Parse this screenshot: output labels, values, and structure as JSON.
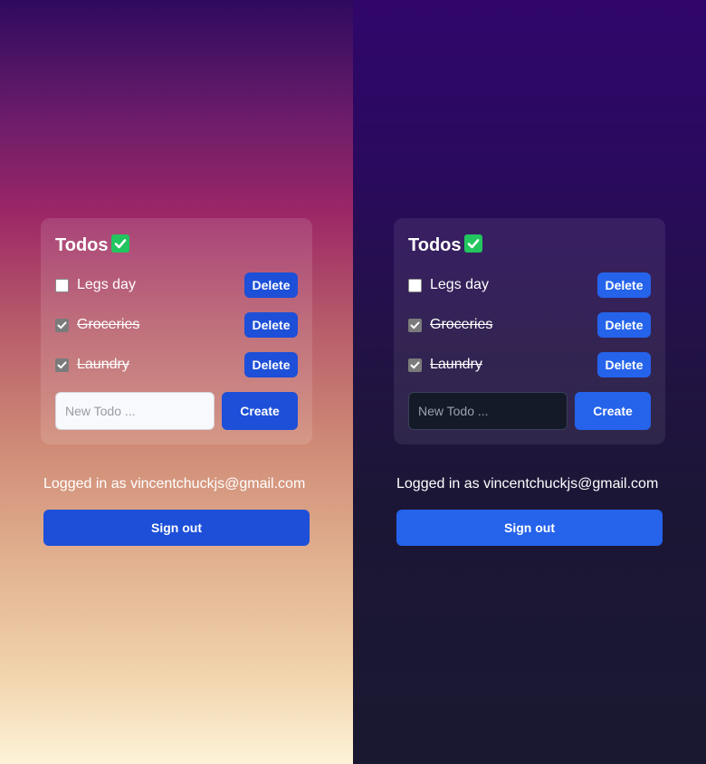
{
  "panels": [
    {
      "theme": "light",
      "title": "Todos",
      "todos": [
        {
          "label": "Legs day",
          "done": false,
          "delete_label": "Delete"
        },
        {
          "label": "Groceries",
          "done": true,
          "delete_label": "Delete"
        },
        {
          "label": "Laundry",
          "done": true,
          "delete_label": "Delete"
        }
      ],
      "new_todo": {
        "placeholder": "New Todo ...",
        "value": ""
      },
      "create_label": "Create",
      "logged_in_text": "Logged in as vincentchuckjs@gmail.com",
      "sign_out_label": "Sign out"
    },
    {
      "theme": "dark",
      "title": "Todos",
      "todos": [
        {
          "label": "Legs day",
          "done": false,
          "delete_label": "Delete"
        },
        {
          "label": "Groceries",
          "done": true,
          "delete_label": "Delete"
        },
        {
          "label": "Laundry",
          "done": true,
          "delete_label": "Delete"
        }
      ],
      "new_todo": {
        "placeholder": "New Todo ...",
        "value": ""
      },
      "create_label": "Create",
      "logged_in_text": "Logged in as vincentchuckjs@gmail.com",
      "sign_out_label": "Sign out"
    }
  ],
  "icons": {
    "title_emoji": "check-mark-button-icon",
    "checkbox_checked": "checkbox-checked-icon",
    "checkbox_unchecked": "checkbox-unchecked-icon"
  },
  "colors": {
    "button_light": "#1d4fd8",
    "button_dark": "#2563eb",
    "emoji_green": "#22c55e",
    "text": "#ffffff"
  }
}
